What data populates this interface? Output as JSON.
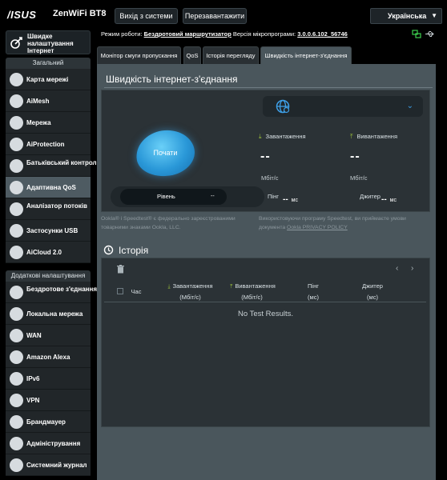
{
  "topbar": {
    "logo": "/ISUS",
    "model": "ZenWiFi BT8",
    "logout_label": "Вихід з системи",
    "reboot_label": "Перезавантажити",
    "language": "Українська"
  },
  "sidebar": {
    "quick_setup_label": "Швидке налаштування Інтернет",
    "general_header": "Загальний",
    "general_items": [
      {
        "label": "Карта мережі",
        "icon": "network-map-icon"
      },
      {
        "label": "AiMesh",
        "icon": "aimesh-icon"
      },
      {
        "label": "Мережа",
        "icon": "network-icon"
      },
      {
        "label": "AiProtection",
        "icon": "aiprotection-icon"
      },
      {
        "label": "Батьківський контроль",
        "icon": "parental-control-icon"
      },
      {
        "label": "Адаптивна QoS",
        "icon": "qos-icon",
        "active": true
      },
      {
        "label": "Аналізатор потоків",
        "icon": "traffic-analyzer-icon"
      },
      {
        "label": "Застосунки USB",
        "icon": "usb-apps-icon"
      },
      {
        "label": "AiCloud 2.0",
        "icon": "aicloud-icon"
      }
    ],
    "advanced_header": "Додаткові налаштування",
    "advanced_items": [
      {
        "label": "Бездротове з'єднання",
        "icon": "wireless-icon"
      },
      {
        "label": "Локальна мережа",
        "icon": "lan-icon"
      },
      {
        "label": "WAN",
        "icon": "wan-icon"
      },
      {
        "label": "Amazon Alexa",
        "icon": "alexa-icon"
      },
      {
        "label": "IPv6",
        "icon": "ipv6-icon"
      },
      {
        "label": "VPN",
        "icon": "vpn-icon"
      },
      {
        "label": "Брандмауер",
        "icon": "firewall-icon"
      },
      {
        "label": "Адміністрування",
        "icon": "administration-icon"
      },
      {
        "label": "Системний журнал",
        "icon": "system-log-icon"
      }
    ]
  },
  "status": {
    "mode_label": "Режим роботи:",
    "mode_value": "Бездротовий маршрутизатор",
    "firmware_label": "Версія мікропрограми:",
    "firmware_value": "3.0.0.6.102_56746"
  },
  "tabs": [
    {
      "label": "Монітор смуги пропускання"
    },
    {
      "label": "QoS"
    },
    {
      "label": "Історія перегляду"
    },
    {
      "label": "Швидкість інтернет-з'єднання",
      "active": true
    }
  ],
  "speedtest": {
    "title": "Швидкість інтернет-з'єднання",
    "go_label": "Почати",
    "download_label": "Завантаження",
    "upload_label": "Вивантаження",
    "download_value": "--",
    "upload_value": "--",
    "download_unit": "Мбіт/с",
    "upload_unit": "Мбіт/с",
    "level_label": "Рівень",
    "level_value": "--",
    "ping_label": "Пінг",
    "ping_value": "--",
    "ping_unit": "мс",
    "jitter_label": "Джитер",
    "jitter_value": "--",
    "jitter_unit": "мс",
    "footnote_left": "Ookla® і Speedtest® є федерально зареєстрованими товарними знаками Ookla, LLC.",
    "footnote_right": "Використовуючи програму Speedtest, ви приймаєте умови документа",
    "footnote_link": "Ookla PRIVACY POLICY"
  },
  "history": {
    "title": "Історія",
    "columns": [
      {
        "label": "Час",
        "unit": ""
      },
      {
        "label": "Завантаження",
        "unit": "(Мбіт/с)"
      },
      {
        "label": "Вивантаження",
        "unit": "(Мбіт/с)"
      },
      {
        "label": "Пінг",
        "unit": "(мс)"
      },
      {
        "label": "Джитер",
        "unit": "(мс)"
      }
    ],
    "empty_message": "No Test Results."
  },
  "colors": {
    "accent_blue": "#2a98d8",
    "panel": "#4a565c",
    "box": "#2b3236",
    "arrow_green": "#9ec43a"
  }
}
